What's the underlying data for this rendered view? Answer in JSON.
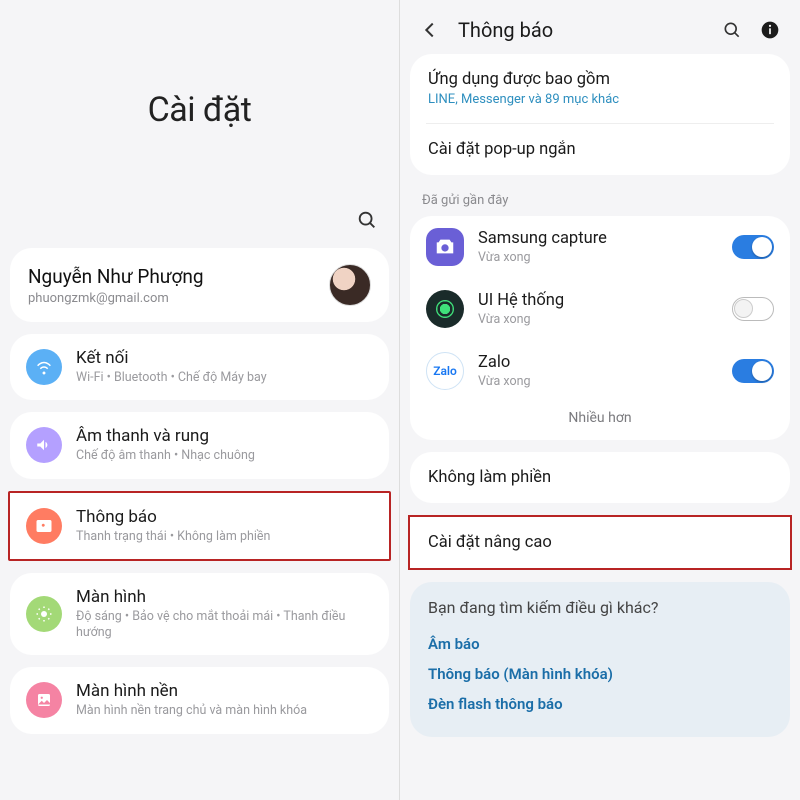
{
  "left": {
    "title": "Cài đặt",
    "profile": {
      "name": "Nguyễn Như Phượng",
      "email": "phuongzmk@gmail.com"
    },
    "items": [
      {
        "title": "Kết nối",
        "sub": "Wi-Fi  •  Bluetooth  •  Chế độ Máy bay",
        "name": "row-connections"
      },
      {
        "title": "Âm thanh và rung",
        "sub": "Chế độ âm thanh  •  Nhạc chuông",
        "name": "row-sound"
      },
      {
        "title": "Thông báo",
        "sub": "Thanh trạng thái  •  Không làm phiền",
        "name": "row-notifications"
      },
      {
        "title": "Màn hình",
        "sub": "Độ sáng  •  Bảo vệ cho mắt thoải mái  •  Thanh điều hướng",
        "name": "row-display"
      },
      {
        "title": "Màn hình nền",
        "sub": "Màn hình nền trang chủ và màn hình khóa",
        "name": "row-wallpaper"
      }
    ]
  },
  "right": {
    "header_title": "Thông báo",
    "included": {
      "title": "Ứng dụng được bao gồm",
      "sub": "LINE, Messenger và 89 mục khác"
    },
    "popup": {
      "title": "Cài đặt pop-up ngắn"
    },
    "recent_label": "Đã gửi gần đây",
    "apps": [
      {
        "title": "Samsung capture",
        "sub": "Vừa xong",
        "toggle": "on",
        "name": "app-samsung-capture"
      },
      {
        "title": "UI Hệ thống",
        "sub": "Vừa xong",
        "toggle": "off",
        "name": "app-system-ui"
      },
      {
        "title": "Zalo",
        "sub": "Vừa xong",
        "toggle": "on",
        "name": "app-zalo"
      }
    ],
    "more": "Nhiều hơn",
    "dnd": "Không làm phiền",
    "advanced": "Cài đặt nâng cao",
    "suggest": {
      "title": "Bạn đang tìm kiếm điều gì khác?",
      "links": [
        "Âm báo",
        "Thông báo (Màn hình khóa)",
        "Đèn flash thông báo"
      ]
    }
  }
}
